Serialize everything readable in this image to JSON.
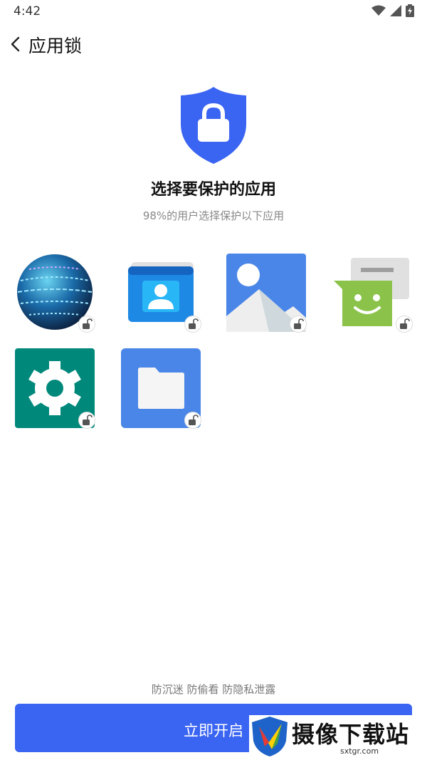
{
  "status_bar": {
    "time": "4:42",
    "icons": [
      "wifi-icon",
      "signal-icon",
      "battery-charging-icon"
    ]
  },
  "app_bar": {
    "title": "应用锁",
    "back_icon": "chevron-left-icon"
  },
  "hero": {
    "icon": "shield-lock-icon",
    "title": "选择要保护的应用",
    "subtitle": "98%的用户选择保护以下应用"
  },
  "apps": [
    {
      "icon": "globe-app-icon",
      "lock_icon": "unlocked-padlock-icon"
    },
    {
      "icon": "contacts-app-icon",
      "lock_icon": "unlocked-padlock-icon"
    },
    {
      "icon": "gallery-app-icon",
      "lock_icon": "unlocked-padlock-icon"
    },
    {
      "icon": "messaging-app-icon",
      "lock_icon": "unlocked-padlock-icon"
    },
    {
      "icon": "settings-app-icon",
      "lock_icon": "unlocked-padlock-icon"
    },
    {
      "icon": "files-app-icon",
      "lock_icon": "unlocked-padlock-icon"
    }
  ],
  "footer": {
    "tagline": "防沉迷 防偷看 防隐私泄露",
    "button_label": "立即开启"
  },
  "watermark": {
    "title": "摄像下载站",
    "url": "sxtgr.com"
  },
  "colors": {
    "primary": "#3a64f2",
    "shield": "#3a64f2",
    "settings_bg": "#00897b",
    "files_bg": "#4a86e8",
    "messaging": "#8bc34a"
  }
}
